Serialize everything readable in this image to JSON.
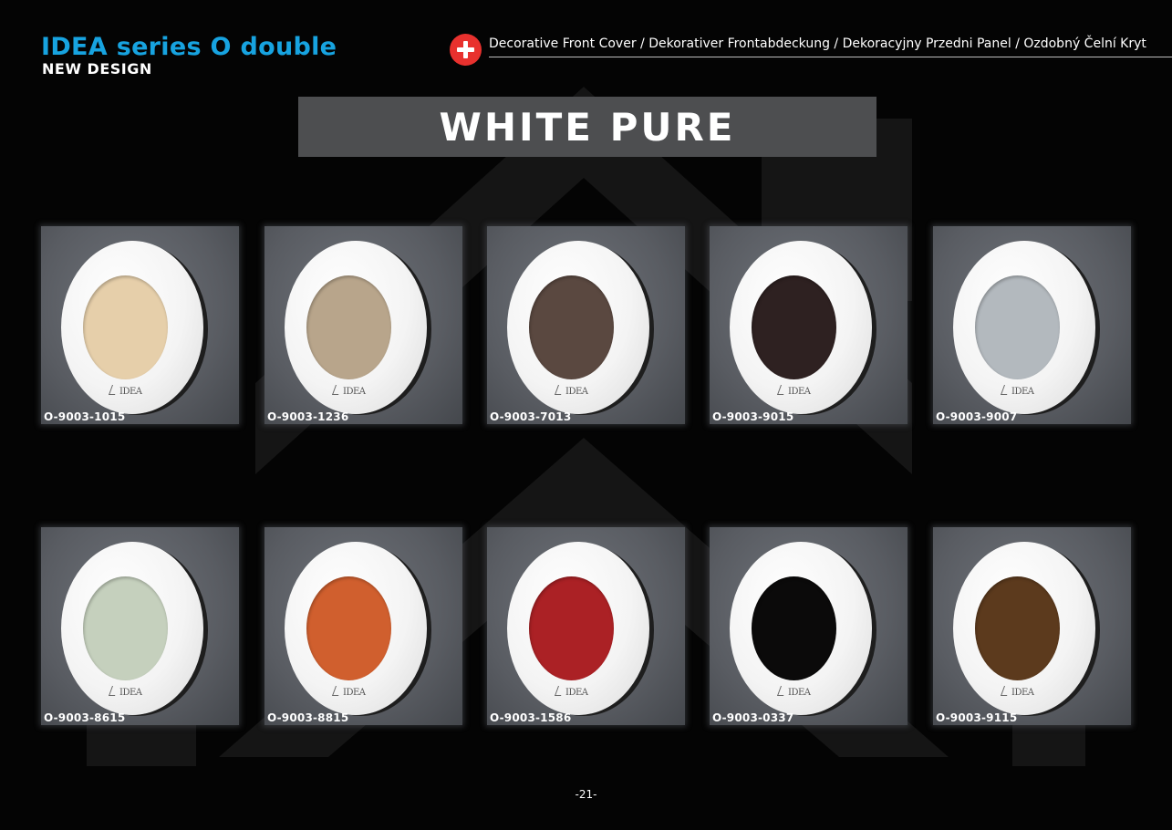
{
  "header": {
    "series_title": "IDEA series O double",
    "series_subtitle": "NEW DESIGN",
    "cover_description": "Decorative Front Cover / Dekorativer Frontabdeckung / Dekoracyjny Przedni Panel / Ozdobný Čelní Kryt",
    "accent_color": "#17a3e0",
    "badge_icon": "plus-icon",
    "badge_color": "#e8312e"
  },
  "banner": {
    "label": "WHITE PURE",
    "background": "#4d4e50"
  },
  "frame_color": "#ffffff",
  "products": [
    {
      "code": "O-9003-1015",
      "insert_color": "#e6cfaa",
      "brand": "IDEA"
    },
    {
      "code": "O-9003-1236",
      "insert_color": "#b8a58b",
      "brand": "IDEA"
    },
    {
      "code": "O-9003-7013",
      "insert_color": "#5a4840",
      "brand": "IDEA"
    },
    {
      "code": "O-9003-9015",
      "insert_color": "#2e2121",
      "brand": "IDEA"
    },
    {
      "code": "O-9003-9007",
      "insert_color": "#b3b9be",
      "brand": "IDEA"
    },
    {
      "code": "O-9003-8615",
      "insert_color": "#c5d0bd",
      "brand": "IDEA"
    },
    {
      "code": "O-9003-8815",
      "insert_color": "#d05f2e",
      "brand": "IDEA"
    },
    {
      "code": "O-9003-1586",
      "insert_color": "#ab2125",
      "brand": "IDEA"
    },
    {
      "code": "O-9003-0337",
      "insert_color": "#0b0a0a",
      "brand": "IDEA"
    },
    {
      "code": "O-9003-9115",
      "insert_color": "#5c3a1d",
      "brand": "IDEA"
    }
  ],
  "footer": {
    "page_number": "-21-"
  }
}
